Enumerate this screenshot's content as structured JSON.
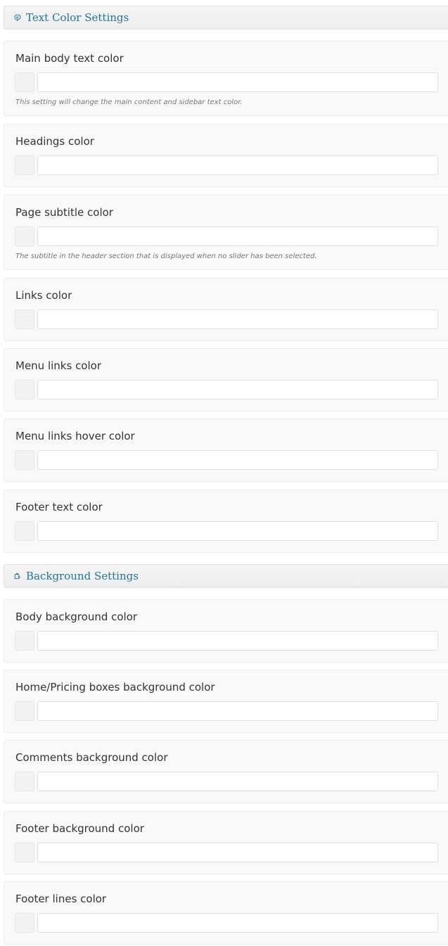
{
  "sections": [
    {
      "title": "Text Color Settings",
      "icon": "palette-icon",
      "accent_color": "#21759b",
      "options": [
        {
          "label": "Main body text color",
          "value": "",
          "description": "This setting will change the main content and sidebar text color."
        },
        {
          "label": "Headings color",
          "value": ""
        },
        {
          "label": "Page subtitle color",
          "value": "",
          "description": "The subtitle in the header section that is displayed when no slider has been selected."
        },
        {
          "label": "Links color",
          "value": ""
        },
        {
          "label": "Menu links color",
          "value": ""
        },
        {
          "label": "Menu links hover color",
          "value": ""
        },
        {
          "label": "Footer text color",
          "value": ""
        }
      ]
    },
    {
      "title": "Background Settings",
      "icon": "paint-bucket-icon",
      "accent_color": "#21759b",
      "options": [
        {
          "label": "Body background color",
          "value": ""
        },
        {
          "label": "Home/Pricing boxes background color",
          "value": ""
        },
        {
          "label": "Comments background color",
          "value": ""
        },
        {
          "label": "Footer background color",
          "value": ""
        },
        {
          "label": "Footer lines color",
          "value": ""
        }
      ]
    }
  ]
}
